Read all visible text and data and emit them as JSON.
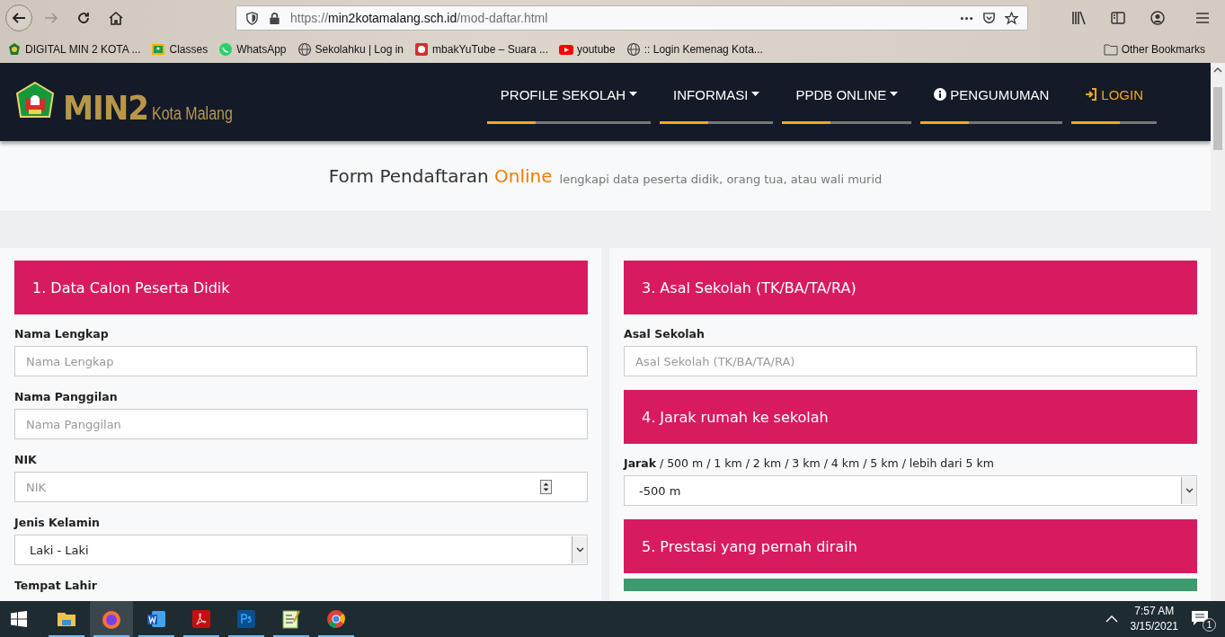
{
  "browser": {
    "url": {
      "scheme": "https://",
      "host": "min2kotamalang.sch.id",
      "path": "/mod-daftar.html"
    },
    "bookmarks": [
      {
        "label": "DIGITAL MIN 2 KOTA ...",
        "kind": "emblem"
      },
      {
        "label": "Classes",
        "kind": "classroom"
      },
      {
        "label": "WhatsApp",
        "kind": "whatsapp"
      },
      {
        "label": "Sekolahku | Log in",
        "kind": "globe"
      },
      {
        "label": "mbakYuTube – Suara ...",
        "kind": "avatar"
      },
      {
        "label": "youtube",
        "kind": "youtube"
      },
      {
        "label": ":: Login Kemenag Kota...",
        "kind": "globe"
      }
    ],
    "other_bookmarks": "Other Bookmarks"
  },
  "site": {
    "logo": {
      "main": "MIN2",
      "sub": "Kota Malang"
    },
    "nav": [
      {
        "label": "PROFILE SEKOLAH",
        "kind": "dropdown"
      },
      {
        "label": "INFORMASI",
        "kind": "dropdown"
      },
      {
        "label": "PPDB ONLINE",
        "kind": "dropdown"
      },
      {
        "label": "PENGUMUMAN",
        "kind": "info"
      },
      {
        "label": "LOGIN",
        "kind": "login"
      }
    ]
  },
  "hero": {
    "title": "Form Pendaftaran",
    "highlight": "Online",
    "subtitle": "lengkapi data peserta didik, orang tua, atau wali murid"
  },
  "form": {
    "columns": [
      {
        "sections": [
          {
            "heading": "1. Data Calon Peserta Didik",
            "color": "#d81b60",
            "fields": [
              {
                "label": "Nama Lengkap",
                "kind": "text",
                "placeholder": "Nama Lengkap"
              },
              {
                "label": "Nama Panggilan",
                "kind": "text",
                "placeholder": "Nama Panggilan"
              },
              {
                "label": "NIK",
                "kind": "number",
                "placeholder": "NIK"
              },
              {
                "label": "Jenis Kelamin",
                "kind": "select",
                "value": "Laki - Laki"
              },
              {
                "label": "Tempat Lahir"
              }
            ]
          }
        ]
      },
      {
        "sections": [
          {
            "heading": "3. Asal Sekolah (TK/BA/TA/RA)",
            "color": "#d81b60",
            "fields": [
              {
                "label": "Asal Sekolah",
                "kind": "text",
                "placeholder": "Asal Sekolah (TK/BA/TA/RA)"
              }
            ]
          },
          {
            "heading": "4. Jarak rumah ke sekolah",
            "color": "#d81b60",
            "fields": [
              {
                "label": "**Jarak** / 500 m / 1 km / 2 km / 3 km / 4 km / 5 km / lebih dari 5 km",
                "kind": "select",
                "value": "-500 m"
              }
            ]
          },
          {
            "heading": "5. Prestasi yang pernah diraih",
            "color": "#d81b60"
          },
          {
            "color": "#3d9a6e"
          }
        ]
      }
    ]
  },
  "taskbar": {
    "apps": [
      {
        "kind": "explorer",
        "selected": false
      },
      {
        "kind": "firefox",
        "selected": true
      },
      {
        "kind": "word",
        "selected": false
      },
      {
        "kind": "acrobat",
        "selected": false
      },
      {
        "kind": "photoshop",
        "selected": false
      },
      {
        "kind": "notepad",
        "selected": false
      },
      {
        "kind": "chrome",
        "selected": false
      }
    ],
    "time": "7:57 AM",
    "date": "3/15/2021",
    "notifications": "1"
  }
}
